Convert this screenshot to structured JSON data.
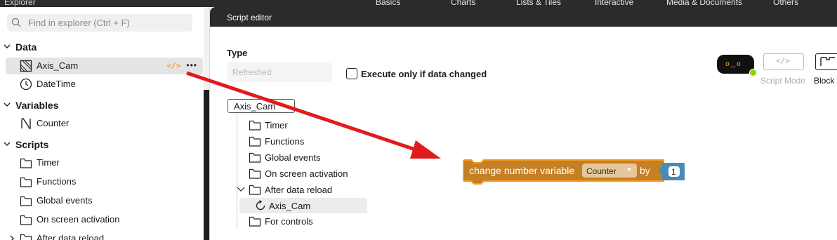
{
  "topbar": {
    "title": "Explorer",
    "nav": [
      "Basics",
      "Charts",
      "Lists & Tiles",
      "Interactive",
      "Media & Documents",
      "Others"
    ]
  },
  "explorer": {
    "search_placeholder": "Find in explorer (Ctrl + F)",
    "sections": {
      "data": {
        "label": "Data",
        "items": [
          {
            "label": "Axis_Cam",
            "icon": "data-source-icon"
          },
          {
            "label": "DateTime",
            "icon": "clock-icon"
          }
        ]
      },
      "variables": {
        "label": "Variables",
        "items": [
          {
            "label": "Counter",
            "icon": "number-variable-icon"
          }
        ]
      },
      "scripts": {
        "label": "Scripts",
        "items": [
          {
            "label": "Timer"
          },
          {
            "label": "Functions"
          },
          {
            "label": "Global events"
          },
          {
            "label": "On screen activation"
          },
          {
            "label": "After data reload"
          }
        ]
      }
    }
  },
  "editor": {
    "title": "Script editor",
    "type_label": "Type",
    "type_value": "Refreshed",
    "execute_only_label": "Execute only if data changed",
    "execute_only_checked": false,
    "source_selector": "Axis_Cam",
    "tree": [
      {
        "label": "Timer"
      },
      {
        "label": "Functions"
      },
      {
        "label": "Global events"
      },
      {
        "label": "On screen activation"
      },
      {
        "label": "After data reload",
        "expanded": true
      },
      {
        "label": "Axis_Cam",
        "selected": true
      },
      {
        "label": "For controls"
      }
    ],
    "modes": {
      "script_label": "Script Mode",
      "block_label": "Block"
    },
    "block": {
      "text_before": "change number variable",
      "variable": "Counter",
      "text_by": "by",
      "value": "1"
    }
  },
  "colors": {
    "block_fill": "#c57f24",
    "block_border": "#f59a1c",
    "number_block": "#4a8ab7",
    "arrow": "#e01b1b",
    "accent_orange": "#f08a24"
  }
}
